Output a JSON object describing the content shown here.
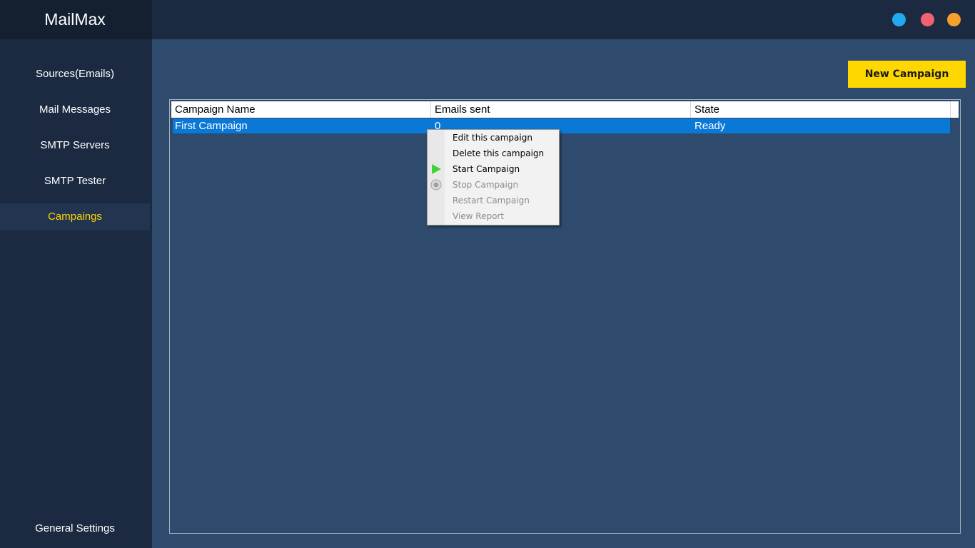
{
  "app": {
    "title": "MailMax"
  },
  "sidebar": {
    "items": [
      {
        "label": "Sources(Emails)"
      },
      {
        "label": "Mail Messages"
      },
      {
        "label": "SMTP Servers"
      },
      {
        "label": "SMTP Tester"
      },
      {
        "label": "Campaings",
        "active": true
      }
    ],
    "footer_label": "General Settings"
  },
  "window_controls": [
    {
      "name": "blue-dot",
      "color": "#22aaf0"
    },
    {
      "name": "red-dot",
      "color": "#f0626f"
    },
    {
      "name": "orange-dot",
      "color": "#f5a02c"
    }
  ],
  "main": {
    "new_campaign_label": "New Campaign",
    "table": {
      "columns": [
        "Campaign Name",
        "Emails sent",
        "State"
      ],
      "rows": [
        {
          "name": "First Campaign",
          "emails_sent": "0",
          "state": "Ready",
          "selected": true
        }
      ]
    }
  },
  "context_menu": {
    "items": [
      {
        "label": "Edit this campaign",
        "enabled": true
      },
      {
        "label": "Delete this campaign",
        "enabled": true
      },
      {
        "label": "Start Campaign",
        "enabled": true,
        "icon": "play-icon"
      },
      {
        "label": "Stop Campaign",
        "enabled": false,
        "icon": "stop-icon"
      },
      {
        "label": "Restart Campaign",
        "enabled": false
      },
      {
        "label": "View Report",
        "enabled": false
      }
    ]
  },
  "colors": {
    "accent": "#ffd700",
    "selection": "#0a78d7",
    "sidebar_bg": "#1b2a41",
    "content_bg": "#2e4a6c"
  }
}
